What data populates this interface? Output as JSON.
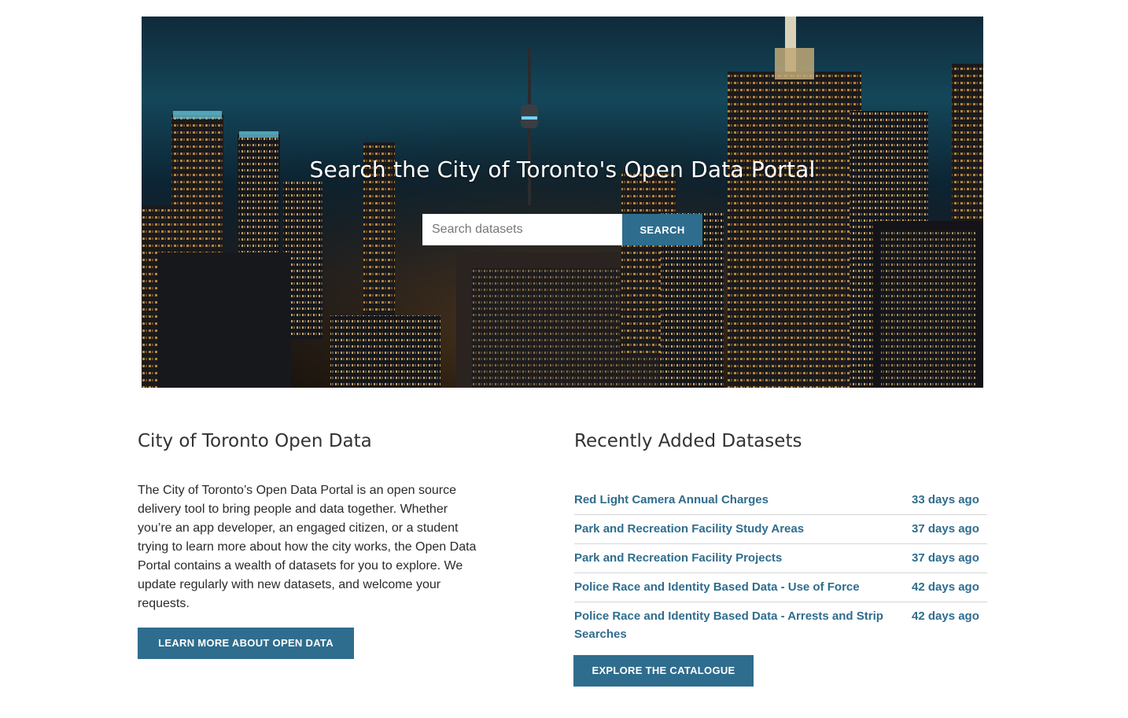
{
  "hero": {
    "title": "Search the City of Toronto's Open Data Portal",
    "search_placeholder": "Search datasets",
    "search_button": "SEARCH"
  },
  "about": {
    "heading": "City of Toronto Open Data",
    "body": "The City of Toronto’s Open Data Portal is an open source delivery tool to bring people and data together. Whether you’re an app developer, an engaged citizen, or a student trying to learn more about how the city works, the Open Data Portal contains a wealth of datasets for you to explore. We update regularly with new datasets, and welcome your requests.",
    "button": "LEARN MORE ABOUT OPEN DATA"
  },
  "recent": {
    "heading": "Recently Added Datasets",
    "items": [
      {
        "name": "Red Light Camera Annual Charges",
        "age": "33 days ago"
      },
      {
        "name": "Park and Recreation Facility Study Areas",
        "age": "37 days ago"
      },
      {
        "name": "Park and Recreation Facility Projects",
        "age": "37 days ago"
      },
      {
        "name": "Police Race and Identity Based Data - Use of Force",
        "age": "42 days ago"
      },
      {
        "name": "Police Race and Identity Based Data - Arrests and Strip Searches",
        "age": "42 days ago"
      }
    ],
    "button": "EXPLORE THE CATALOGUE"
  },
  "colors": {
    "accent": "#2f6d8e",
    "link": "#2f6d8e"
  }
}
